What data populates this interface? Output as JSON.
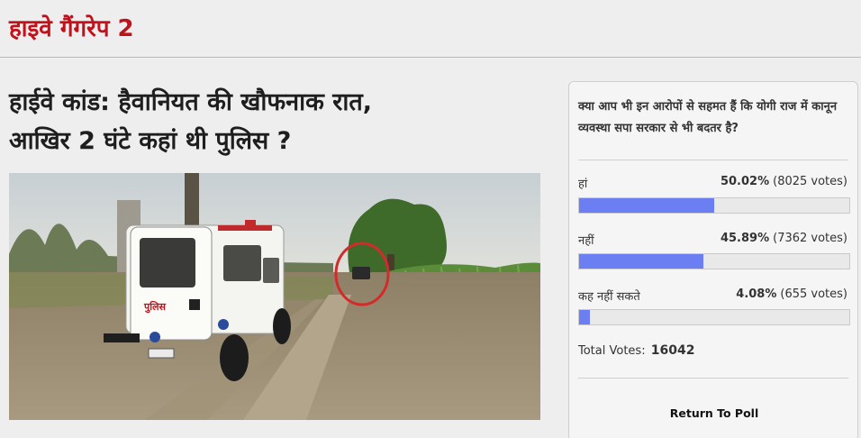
{
  "topic": {
    "title": "हाइवे गैंगरेप 2"
  },
  "article": {
    "headline_line1": "हाईवे कांड: हैवानियत की खौफनाक रात,",
    "headline_line2": "आखिर 2 घंटे कहां थी पुलिस ?",
    "photo": {
      "vehicle_text": "पुलिस",
      "highlight_color": "#d42a2a"
    }
  },
  "poll": {
    "question": "क्या आप भी इन आरोपों से सहमत हैं कि योगी राज में कानून व्यवस्था सपा सरकार से भी बदतर है?",
    "bar_color": "#6b7ff2",
    "options": [
      {
        "label": "हां",
        "percent": "50.02%",
        "votes": "(8025 votes)",
        "fraction": 0.5002
      },
      {
        "label": "नहीं",
        "percent": "45.89%",
        "votes": "(7362 votes)",
        "fraction": 0.4589
      },
      {
        "label": "कह नहीं सकते",
        "percent": "4.08%",
        "votes": "(655 votes)",
        "fraction": 0.0408
      }
    ],
    "total_label": "Total Votes:",
    "total_value": "16042",
    "return_label": "Return To Poll"
  }
}
